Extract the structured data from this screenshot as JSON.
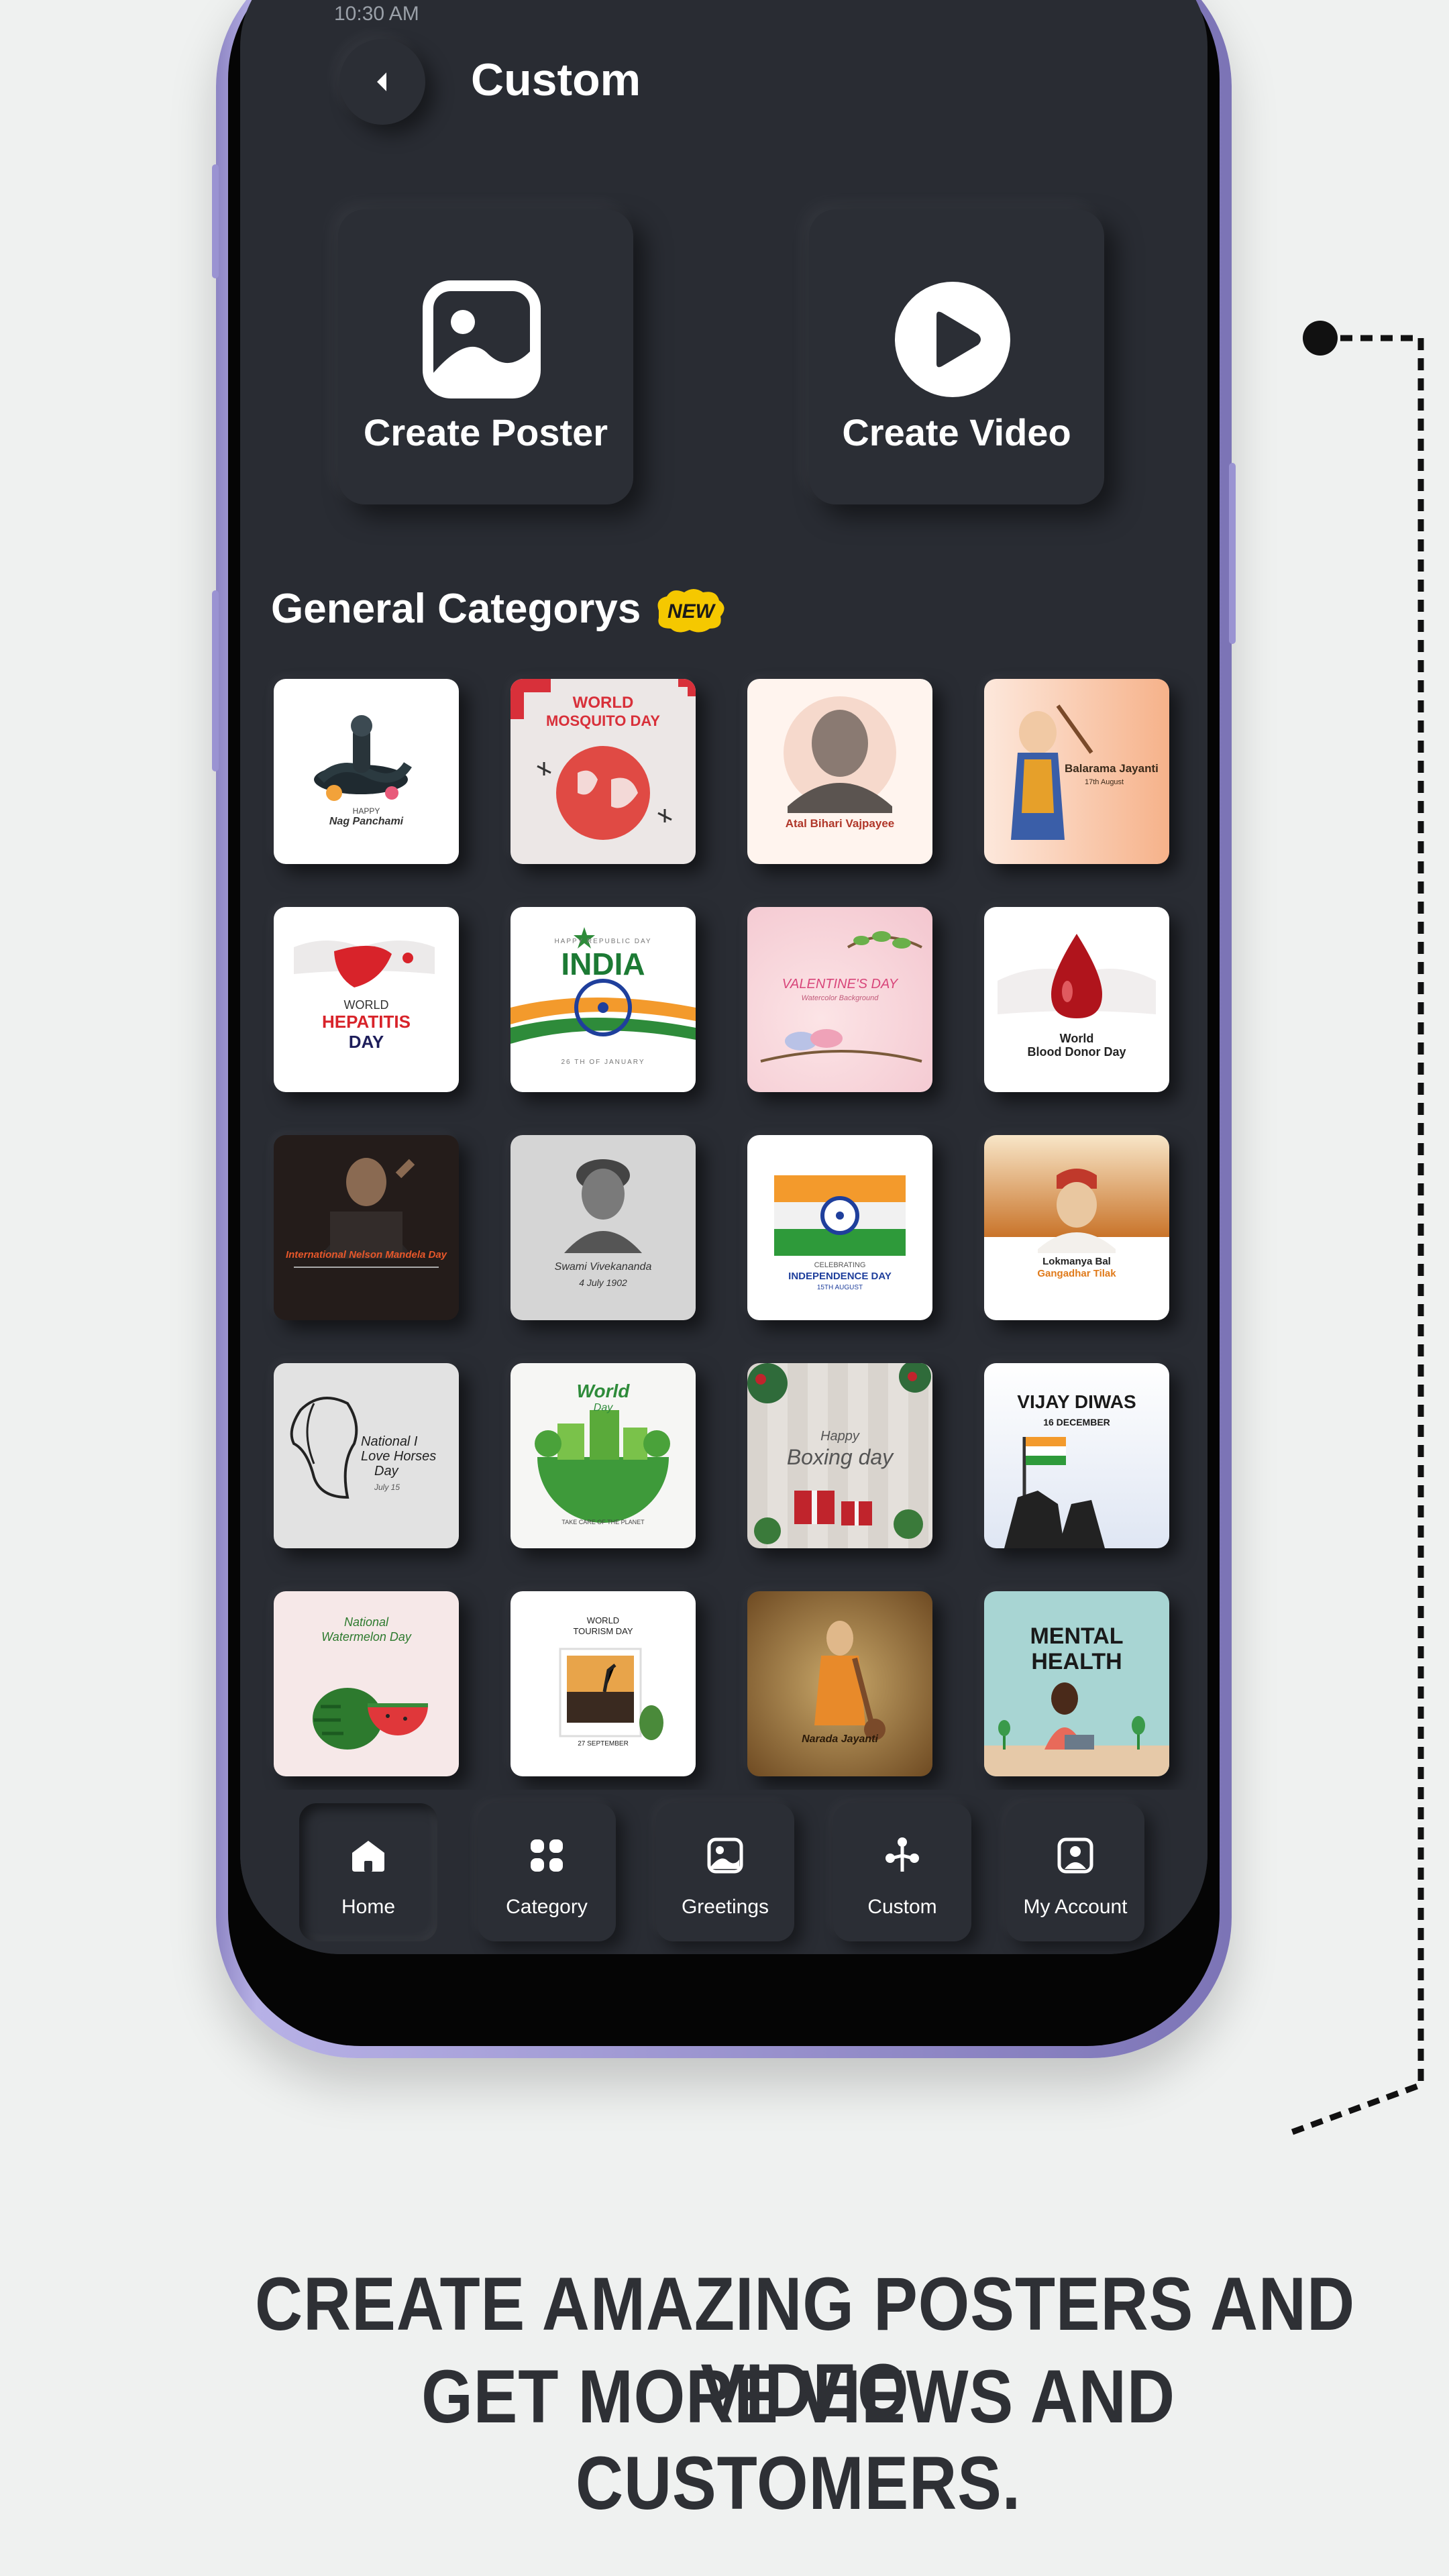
{
  "header": {
    "title": "Custom",
    "status_time": "10:30 AM"
  },
  "create": {
    "poster_label": "Create Poster",
    "video_label": "Create Video"
  },
  "section": {
    "title": "General Categorys",
    "badge": "NEW"
  },
  "categories": [
    {
      "name": "Nag Panchami",
      "line1": "HAPPY",
      "line2": "Nag Panchami"
    },
    {
      "name": "World Mosquito Day",
      "line1": "WORLD",
      "line2": "MOSQUITO DAY"
    },
    {
      "name": "Atal Bihari Vajpayee",
      "line1": "Atal Bihari Vajpayee",
      "line2": ""
    },
    {
      "name": "Balarama Jayanti",
      "line1": "Balarama Jayanti",
      "line2": "17th August"
    },
    {
      "name": "World Hepatitis Day",
      "line1": "WORLD",
      "line2": "HEPATITIS",
      "line3": "DAY"
    },
    {
      "name": "Republic Day India",
      "line1": "HAPPY REPUBLIC DAY",
      "line2": "INDIA",
      "line3": "26 TH OF JANUARY"
    },
    {
      "name": "Valentine's Day",
      "line1": "VALENTINE'S DAY",
      "line2": "Watercolor Background"
    },
    {
      "name": "World Blood Donor Day",
      "line1": "World",
      "line2": "Blood Donor Day"
    },
    {
      "name": "Nelson Mandela Day",
      "line1": "International Nelson Mandela Day",
      "line2": ""
    },
    {
      "name": "Swami Vivekananda",
      "line1": "Swami Vivekananda",
      "line2": "4 July 1902"
    },
    {
      "name": "Independence Day",
      "line1": "CELEBRATING",
      "line2": "INDEPENDENCE DAY",
      "line3": "15TH AUGUST"
    },
    {
      "name": "Lokmanya Bal Gangadhar Tilak",
      "line1": "Lokmanya Bal",
      "line2": "Gangadhar Tilak"
    },
    {
      "name": "National I Love Horses Day",
      "line1": "National I",
      "line2": "Love Horses",
      "line3": "Day",
      "line4": "July 15"
    },
    {
      "name": "World Environment Day",
      "line1": "World",
      "line2": "Day",
      "line3": "TAKE CARE OF THE PLANET"
    },
    {
      "name": "Boxing Day",
      "line1": "Happy",
      "line2": "Boxing day"
    },
    {
      "name": "Vijay Diwas",
      "line1": "VIJAY DIWAS",
      "line2": "16 DECEMBER"
    },
    {
      "name": "National Watermelon Day",
      "line1": "National",
      "line2": "Watermelon Day"
    },
    {
      "name": "World Tourism Day",
      "line1": "WORLD",
      "line2": "TOURISM DAY",
      "line3": "27 SEPTEMBER"
    },
    {
      "name": "Narada Jayanti",
      "line1": "Narada Jayanti",
      "line2": ""
    },
    {
      "name": "Mental Health",
      "line1": "MENTAL",
      "line2": "HEALTH"
    }
  ],
  "nav": {
    "home": "Home",
    "category": "Category",
    "greetings": "Greetings",
    "custom": "Custom",
    "account": "My Account"
  },
  "tagline": {
    "line1": "CREATE AMAZING POSTERS AND VIDEO",
    "line2": "GET MORE VIEWS AND CUSTOMERS."
  },
  "colors": {
    "screen_bg": "#292c33",
    "frame_accent": "#8e86c4",
    "page_bg": "#eff1f0",
    "badge": "#f5c800"
  }
}
